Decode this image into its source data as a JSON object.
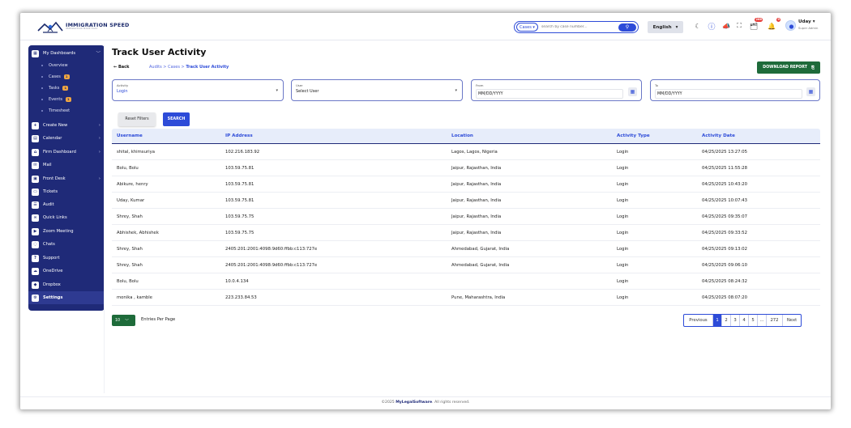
{
  "header": {
    "logo_name": "IMMIGRATION SPEED",
    "logo_tagline": "IMMIGRATION MADE EASY",
    "search_type": "Cases",
    "search_placeholder": "search by case number...",
    "language": "English",
    "notifications": {
      "chat": "",
      "cases": "268",
      "alerts": "0"
    },
    "user_name": "Uday",
    "user_role": "Super Admin"
  },
  "sidebar": {
    "items": [
      {
        "label": "My Dashboards",
        "icon": "dashboard-icon"
      },
      {
        "label": "Create New",
        "icon": "plus-icon"
      },
      {
        "label": "Calendar",
        "icon": "calendar-icon"
      },
      {
        "label": "Firm Dashboard",
        "icon": "firm-icon"
      },
      {
        "label": "Mail",
        "icon": "mail-icon"
      },
      {
        "label": "Front Desk",
        "icon": "front-desk-icon"
      },
      {
        "label": "Tickets",
        "icon": "ticket-icon"
      },
      {
        "label": "Audit",
        "icon": "audit-icon"
      },
      {
        "label": "Quick Links",
        "icon": "link-icon"
      },
      {
        "label": "Zoom Meeting",
        "icon": "video-icon"
      },
      {
        "label": "Chats",
        "icon": "chat-icon"
      },
      {
        "label": "Support",
        "icon": "support-icon"
      },
      {
        "label": "OneDrive",
        "icon": "cloud-icon"
      },
      {
        "label": "Dropbox",
        "icon": "dropbox-icon"
      },
      {
        "label": "Settings",
        "icon": "settings-icon"
      }
    ],
    "sub_items": [
      {
        "label": "Overview",
        "count": ""
      },
      {
        "label": "Cases",
        "count": "1"
      },
      {
        "label": "Tasks",
        "count": "1"
      },
      {
        "label": "Events",
        "count": "1"
      },
      {
        "label": "Timesheet",
        "count": ""
      }
    ]
  },
  "page": {
    "title": "Track User Activity",
    "back_label": "Back",
    "breadcrumb": [
      "Audits",
      "Cases",
      "Track User Activity"
    ],
    "download_label": "DOWNLOAD REPORT"
  },
  "filters": {
    "activity_label": "Activity",
    "activity_value": "Login",
    "user_label": "User",
    "user_value": "Select User",
    "from_label": "From",
    "from_value": "MM/DD/YYYY",
    "to_label": "To",
    "to_value": "MM/DD/YYYY",
    "reset_label": "Reset Filters",
    "search_label": "SEARCH"
  },
  "table": {
    "columns": [
      "Username",
      "IP Address",
      "Location",
      "Activity Type",
      "Activity Date"
    ],
    "rows": [
      [
        "shital, khimsuriya",
        "102.216.183.92",
        "Lagos, Lagos, Nigeria",
        "Login",
        "04/25/2025 13:27:05"
      ],
      [
        "Bolu, Bolu",
        "103.59.75.81",
        "Jaipur, Rajasthan, India",
        "Login",
        "04/25/2025 11:55:28"
      ],
      [
        "Abikure, henry",
        "103.59.75.81",
        "Jaipur, Rajasthan, India",
        "Login",
        "04/25/2025 10:43:20"
      ],
      [
        "Uday, Kumar",
        "103.59.75.81",
        "Jaipur, Rajasthan, India",
        "Login",
        "04/25/2025 10:07:43"
      ],
      [
        "Shrey, Shah",
        "103.59.75.75",
        "Jaipur, Rajasthan, India",
        "Login",
        "04/25/2025 09:35:07"
      ],
      [
        "Abhishek, Abhishek",
        "103.59.75.75",
        "Jaipur, Rajasthan, India",
        "Login",
        "04/25/2025 09:33:52"
      ],
      [
        "Shrey, Shah",
        "2405:201:2001:4098:9d60:ffbb:c113:727e",
        "Ahmedabad, Gujarat, India",
        "Login",
        "04/25/2025 09:13:02"
      ],
      [
        "Shrey, Shah",
        "2405:201:2001:4098:9d60:ffbb:c113:727e",
        "Ahmedabad, Gujarat, India",
        "Login",
        "04/25/2025 09:06:10"
      ],
      [
        "Bolu, Bolu",
        "10.0.4.134",
        "",
        "Login",
        "04/25/2025 08:24:32"
      ],
      [
        "monika , kamble",
        "223.233.84.53",
        "Pune, Maharashtra, India",
        "Login",
        "04/25/2025 08:07:20"
      ]
    ]
  },
  "pagination": {
    "per_page": "10",
    "per_page_label": "Entries Per Page",
    "previous": "Previous",
    "pages": [
      "1",
      "2",
      "3",
      "4",
      "5",
      "...",
      "272"
    ],
    "next": "Next"
  },
  "footer": {
    "prefix": "©2025",
    "brand": "MyLegalSoftware",
    "suffix": ". All rights reserved."
  },
  "colors": {
    "primary": "#2d4bd8",
    "sidebar": "#1f2a78",
    "download": "#1e6b3a",
    "table_header": "#e7edfa"
  }
}
